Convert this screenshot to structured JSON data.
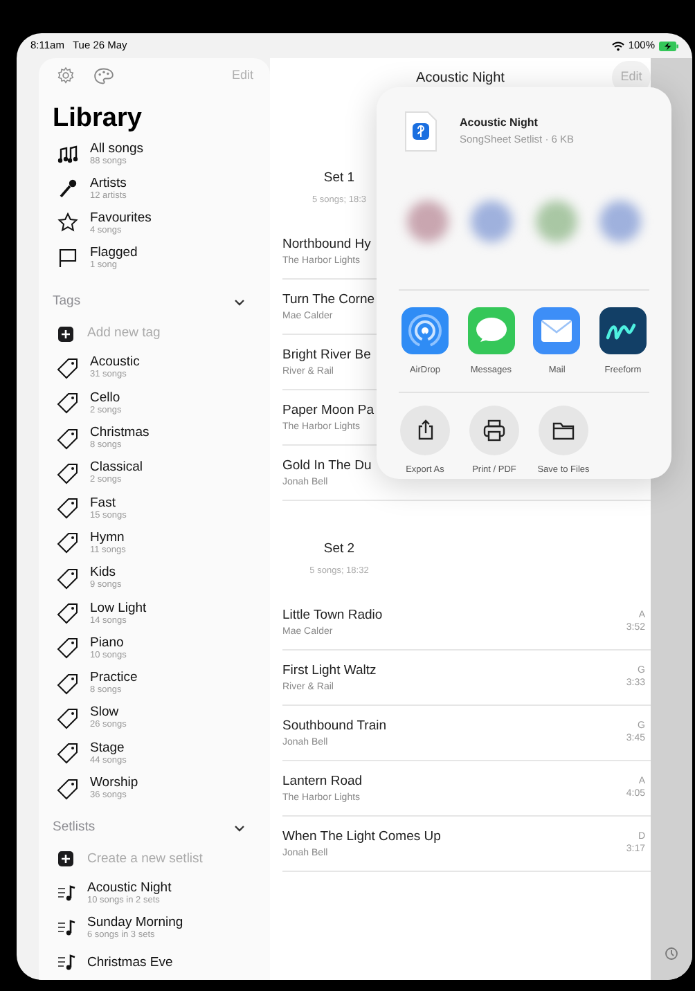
{
  "status_bar": {
    "time": "8:11am",
    "date": "Tue 26 May",
    "battery": "100%"
  },
  "sidebar": {
    "edit": "Edit",
    "title": "Library",
    "library": [
      {
        "kind": "songs",
        "label": "All songs",
        "detail": "88 songs"
      },
      {
        "kind": "artists",
        "label": "Artists",
        "detail": "12 artists"
      },
      {
        "kind": "favourites",
        "label": "Favourites",
        "detail": "4 songs"
      },
      {
        "kind": "flagged",
        "label": "Flagged",
        "detail": "1 song"
      }
    ],
    "tags_header": "Tags",
    "tags_expanded": true,
    "add_tag": "Add new tag",
    "tags": [
      {
        "label": "Acoustic",
        "detail": "31 songs"
      },
      {
        "label": "Cello",
        "detail": "2 songs"
      },
      {
        "label": "Christmas",
        "detail": "8 songs"
      },
      {
        "label": "Classical",
        "detail": "2 songs"
      },
      {
        "label": "Fast",
        "detail": "15 songs"
      },
      {
        "label": "Hymn",
        "detail": "11 songs"
      },
      {
        "label": "Kids",
        "detail": "9 songs"
      },
      {
        "label": "Low Light",
        "detail": "14 songs"
      },
      {
        "label": "Piano",
        "detail": "10 songs"
      },
      {
        "label": "Practice",
        "detail": "8 songs"
      },
      {
        "label": "Slow",
        "detail": "26 songs"
      },
      {
        "label": "Stage",
        "detail": "44 songs"
      },
      {
        "label": "Worship",
        "detail": "36 songs"
      }
    ],
    "setlists_header": "Setlists",
    "setlists_expanded": true,
    "create_setlist": "Create a new setlist",
    "setlists": [
      {
        "label": "Acoustic Night",
        "detail": "10 songs in 2 sets"
      },
      {
        "label": "Sunday Morning",
        "detail": "6 songs in 3 sets"
      },
      {
        "label": "Christmas Eve"
      }
    ]
  },
  "main": {
    "title": "Acoustic Night",
    "edit": "Edit",
    "sets": [
      {
        "title": "Set 1",
        "summary": "5 songs; 18:3",
        "songs": [
          {
            "title": "Northbound Hy",
            "artist": "The Harbor Lights"
          },
          {
            "title": "Turn The Corne",
            "artist": "Mae Calder"
          },
          {
            "title": "Bright River Be",
            "artist": "River & Rail"
          },
          {
            "title": "Paper Moon Pa",
            "artist": "The Harbor Lights"
          },
          {
            "title": "Gold In The Du",
            "artist": "Jonah Bell"
          }
        ]
      },
      {
        "title": "Set 2",
        "summary": "5 songs; 18:32",
        "songs": [
          {
            "title": "Little Town Radio",
            "artist": "Mae Calder",
            "key": "A",
            "duration": "3:52"
          },
          {
            "title": "First Light Waltz",
            "artist": "River & Rail",
            "key": "G",
            "duration": "3:33"
          },
          {
            "title": "Southbound Train",
            "artist": "Jonah Bell",
            "key": "G",
            "duration": "3:45"
          },
          {
            "title": "Lantern Road",
            "artist": "The Harbor Lights",
            "key": "A",
            "duration": "4:05"
          },
          {
            "title": "When The Light Comes Up",
            "artist": "Jonah Bell",
            "key": "D",
            "duration": "3:17"
          }
        ]
      }
    ]
  },
  "share_sheet": {
    "file_title": "Acoustic Night",
    "file_info": "SongSheet Setlist · 6 KB",
    "apps": [
      {
        "kind": "airdrop",
        "label": "AirDrop"
      },
      {
        "kind": "messages",
        "label": "Messages"
      },
      {
        "kind": "mail",
        "label": "Mail"
      },
      {
        "kind": "freeform",
        "label": "Freeform"
      }
    ],
    "actions": [
      {
        "kind": "export",
        "label": "Export As"
      },
      {
        "kind": "print",
        "label": "Print / PDF"
      },
      {
        "kind": "files",
        "label": "Save to Files"
      }
    ]
  }
}
